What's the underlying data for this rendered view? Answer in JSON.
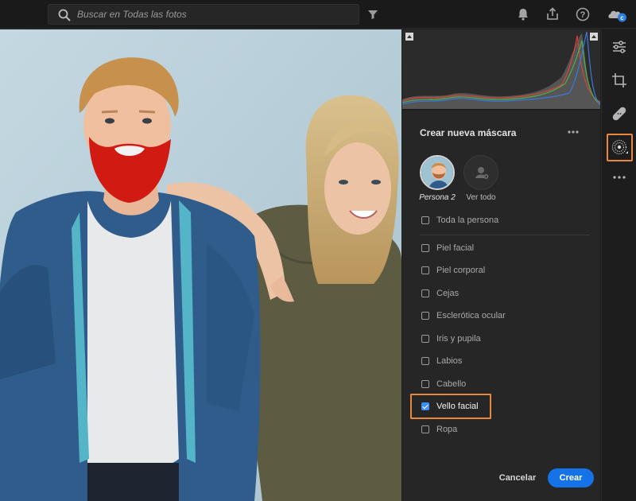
{
  "topbar": {
    "search_placeholder": "Buscar en Todas las fotos",
    "icons": [
      "search-icon",
      "filter-icon",
      "bell-icon",
      "share-icon",
      "help-icon",
      "cloud-icon"
    ]
  },
  "panel": {
    "title": "Crear nueva máscara",
    "people": [
      {
        "label": "Persona 2",
        "selected": true
      },
      {
        "label": "Ver todo",
        "selected": false
      }
    ],
    "whole_person": {
      "label": "Toda la persona",
      "checked": false
    },
    "parts": [
      {
        "label": "Piel facial",
        "checked": false
      },
      {
        "label": "Piel corporal",
        "checked": false
      },
      {
        "label": "Cejas",
        "checked": false
      },
      {
        "label": "Esclerótica ocular",
        "checked": false
      },
      {
        "label": "Iris y pupila",
        "checked": false
      },
      {
        "label": "Labios",
        "checked": false
      },
      {
        "label": "Cabello",
        "checked": false
      },
      {
        "label": "Vello facial",
        "checked": true
      },
      {
        "label": "Ropa",
        "checked": false
      }
    ],
    "cancel_label": "Cancelar",
    "create_label": "Crear"
  },
  "rail": {
    "tools": [
      "edit-sliders-icon",
      "crop-icon",
      "heal-icon",
      "masking-icon",
      "more-icon"
    ],
    "active_tool": "masking-icon"
  },
  "colors": {
    "accent": "#1473e6",
    "highlight": "#e9873c",
    "mask_overlay": "#d11a12",
    "check_blue": "#3e8ef7"
  }
}
